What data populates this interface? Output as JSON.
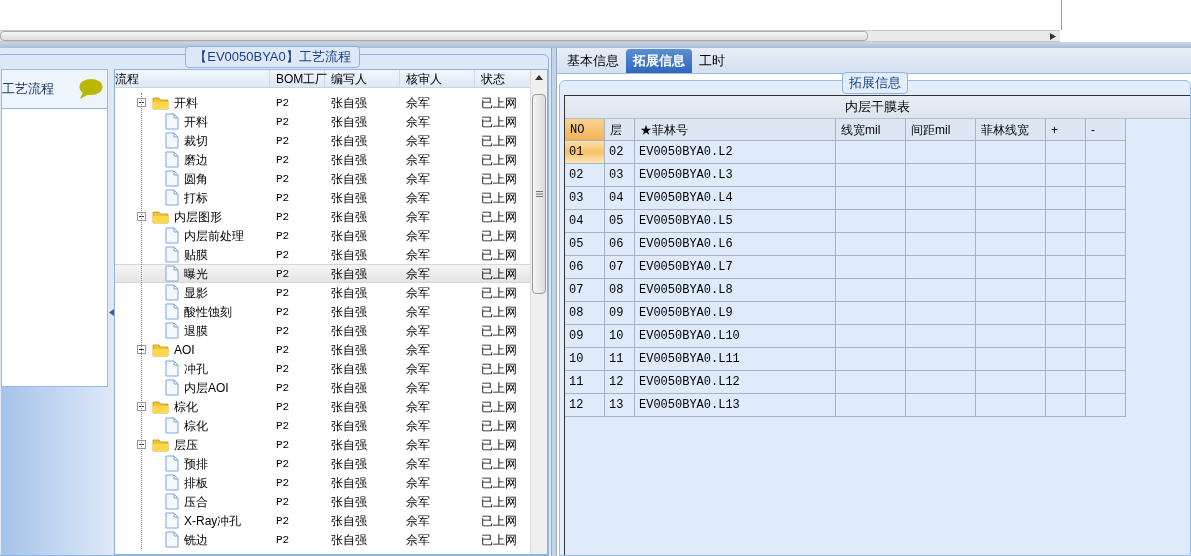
{
  "left_panel": {
    "title": "【EV0050BYA0】工艺流程",
    "sidebar": {
      "items": [
        {
          "label": "工艺流程",
          "selected": true
        }
      ]
    },
    "tree": {
      "columns": [
        "流程",
        "BOM工厂",
        "编写人",
        "核审人",
        "状态"
      ],
      "nodes": [
        {
          "kind": "folder",
          "label": "开料",
          "bom": "P2",
          "writer": "张自强",
          "reviewer": "佘军",
          "status": "已上网",
          "expanded": true,
          "selected": false,
          "children": [
            {
              "kind": "file",
              "label": "开料",
              "bom": "P2",
              "writer": "张自强",
              "reviewer": "佘军",
              "status": "已上网",
              "selected": false
            },
            {
              "kind": "file",
              "label": "裁切",
              "bom": "P2",
              "writer": "张自强",
              "reviewer": "佘军",
              "status": "已上网",
              "selected": false
            },
            {
              "kind": "file",
              "label": "磨边",
              "bom": "P2",
              "writer": "张自强",
              "reviewer": "佘军",
              "status": "已上网",
              "selected": false
            },
            {
              "kind": "file",
              "label": "圆角",
              "bom": "P2",
              "writer": "张自强",
              "reviewer": "佘军",
              "status": "已上网",
              "selected": false
            },
            {
              "kind": "file",
              "label": "打标",
              "bom": "P2",
              "writer": "张自强",
              "reviewer": "佘军",
              "status": "已上网",
              "selected": false
            }
          ]
        },
        {
          "kind": "folder",
          "label": "内层图形",
          "bom": "P2",
          "writer": "张自强",
          "reviewer": "佘军",
          "status": "已上网",
          "expanded": true,
          "selected": false,
          "children": [
            {
              "kind": "file",
              "label": "内层前处理",
              "bom": "P2",
              "writer": "张自强",
              "reviewer": "佘军",
              "status": "已上网",
              "selected": false
            },
            {
              "kind": "file",
              "label": "贴膜",
              "bom": "P2",
              "writer": "张自强",
              "reviewer": "佘军",
              "status": "已上网",
              "selected": false
            },
            {
              "kind": "file",
              "label": "曝光",
              "bom": "P2",
              "writer": "张自强",
              "reviewer": "佘军",
              "status": "已上网",
              "selected": true
            },
            {
              "kind": "file",
              "label": "显影",
              "bom": "P2",
              "writer": "张自强",
              "reviewer": "佘军",
              "status": "已上网",
              "selected": false
            },
            {
              "kind": "file",
              "label": "酸性蚀刻",
              "bom": "P2",
              "writer": "张自强",
              "reviewer": "佘军",
              "status": "已上网",
              "selected": false
            },
            {
              "kind": "file",
              "label": "退膜",
              "bom": "P2",
              "writer": "张自强",
              "reviewer": "佘军",
              "status": "已上网",
              "selected": false
            }
          ]
        },
        {
          "kind": "folder",
          "label": "AOI",
          "bom": "P2",
          "writer": "张自强",
          "reviewer": "佘军",
          "status": "已上网",
          "expanded": true,
          "selected": false,
          "children": [
            {
              "kind": "file",
              "label": "冲孔",
              "bom": "P2",
              "writer": "张自强",
              "reviewer": "佘军",
              "status": "已上网",
              "selected": false
            },
            {
              "kind": "file",
              "label": "内层AOI",
              "bom": "P2",
              "writer": "张自强",
              "reviewer": "佘军",
              "status": "已上网",
              "selected": false
            }
          ]
        },
        {
          "kind": "folder",
          "label": "棕化",
          "bom": "P2",
          "writer": "张自强",
          "reviewer": "佘军",
          "status": "已上网",
          "expanded": true,
          "selected": false,
          "children": [
            {
              "kind": "file",
              "label": "棕化",
              "bom": "P2",
              "writer": "张自强",
              "reviewer": "佘军",
              "status": "已上网",
              "selected": false
            }
          ]
        },
        {
          "kind": "folder",
          "label": "层压",
          "bom": "P2",
          "writer": "张自强",
          "reviewer": "佘军",
          "status": "已上网",
          "expanded": true,
          "selected": false,
          "children": [
            {
              "kind": "file",
              "label": "预排",
              "bom": "P2",
              "writer": "张自强",
              "reviewer": "佘军",
              "status": "已上网",
              "selected": false
            },
            {
              "kind": "file",
              "label": "排板",
              "bom": "P2",
              "writer": "张自强",
              "reviewer": "佘军",
              "status": "已上网",
              "selected": false
            },
            {
              "kind": "file",
              "label": "压合",
              "bom": "P2",
              "writer": "张自强",
              "reviewer": "佘军",
              "status": "已上网",
              "selected": false
            },
            {
              "kind": "file",
              "label": "X-Ray冲孔",
              "bom": "P2",
              "writer": "张自强",
              "reviewer": "佘军",
              "status": "已上网",
              "selected": false
            },
            {
              "kind": "file",
              "label": "铣边",
              "bom": "P2",
              "writer": "张自强",
              "reviewer": "佘军",
              "status": "已上网",
              "selected": false
            }
          ]
        }
      ]
    }
  },
  "right_panel": {
    "tabs": [
      {
        "label": "基本信息",
        "selected": false
      },
      {
        "label": "拓展信息",
        "selected": true
      },
      {
        "label": "工时",
        "selected": false
      }
    ],
    "group_title": "拓展信息",
    "table": {
      "title": "内层干膜表",
      "columns": [
        "NO",
        "层",
        "★菲林号",
        "线宽mil",
        "间距mil",
        "菲林线宽",
        "+",
        "-"
      ],
      "rows": [
        {
          "no": "01",
          "layer": "02",
          "film": "EV0050BYA0.L2",
          "selected": true
        },
        {
          "no": "02",
          "layer": "03",
          "film": "EV0050BYA0.L3",
          "selected": false
        },
        {
          "no": "03",
          "layer": "04",
          "film": "EV0050BYA0.L4",
          "selected": false
        },
        {
          "no": "04",
          "layer": "05",
          "film": "EV0050BYA0.L5",
          "selected": false
        },
        {
          "no": "05",
          "layer": "06",
          "film": "EV0050BYA0.L6",
          "selected": false
        },
        {
          "no": "06",
          "layer": "07",
          "film": "EV0050BYA0.L7",
          "selected": false
        },
        {
          "no": "07",
          "layer": "08",
          "film": "EV0050BYA0.L8",
          "selected": false
        },
        {
          "no": "08",
          "layer": "09",
          "film": "EV0050BYA0.L9",
          "selected": false
        },
        {
          "no": "09",
          "layer": "10",
          "film": "EV0050BYA0.L10",
          "selected": false
        },
        {
          "no": "10",
          "layer": "11",
          "film": "EV0050BYA0.L11",
          "selected": false
        },
        {
          "no": "11",
          "layer": "12",
          "film": "EV0050BYA0.L12",
          "selected": false
        },
        {
          "no": "12",
          "layer": "13",
          "film": "EV0050BYA0.L13",
          "selected": false
        }
      ]
    }
  }
}
